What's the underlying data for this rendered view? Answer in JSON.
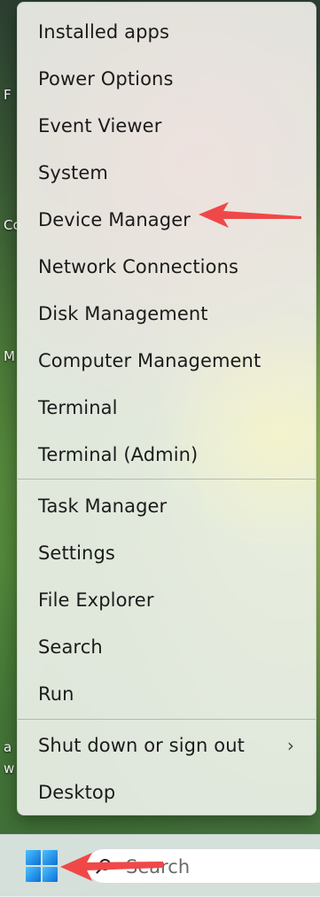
{
  "desktop": {
    "labels": [
      "F",
      "Co",
      "M",
      "a",
      "w"
    ]
  },
  "menu": {
    "group1": [
      "Installed apps",
      "Power Options",
      "Event Viewer",
      "System",
      "Device Manager",
      "Network Connections",
      "Disk Management",
      "Computer Management",
      "Terminal",
      "Terminal (Admin)"
    ],
    "group2": [
      "Task Manager",
      "Settings",
      "File Explorer",
      "Search",
      "Run"
    ],
    "group3": [
      "Shut down or sign out",
      "Desktop"
    ],
    "submenu_chevron": "›"
  },
  "taskbar": {
    "search_placeholder": "Search",
    "start_icon": "windows-logo-icon",
    "search_icon": "magnifier-icon"
  },
  "annotations": {
    "arrow_color": "#f04848"
  }
}
